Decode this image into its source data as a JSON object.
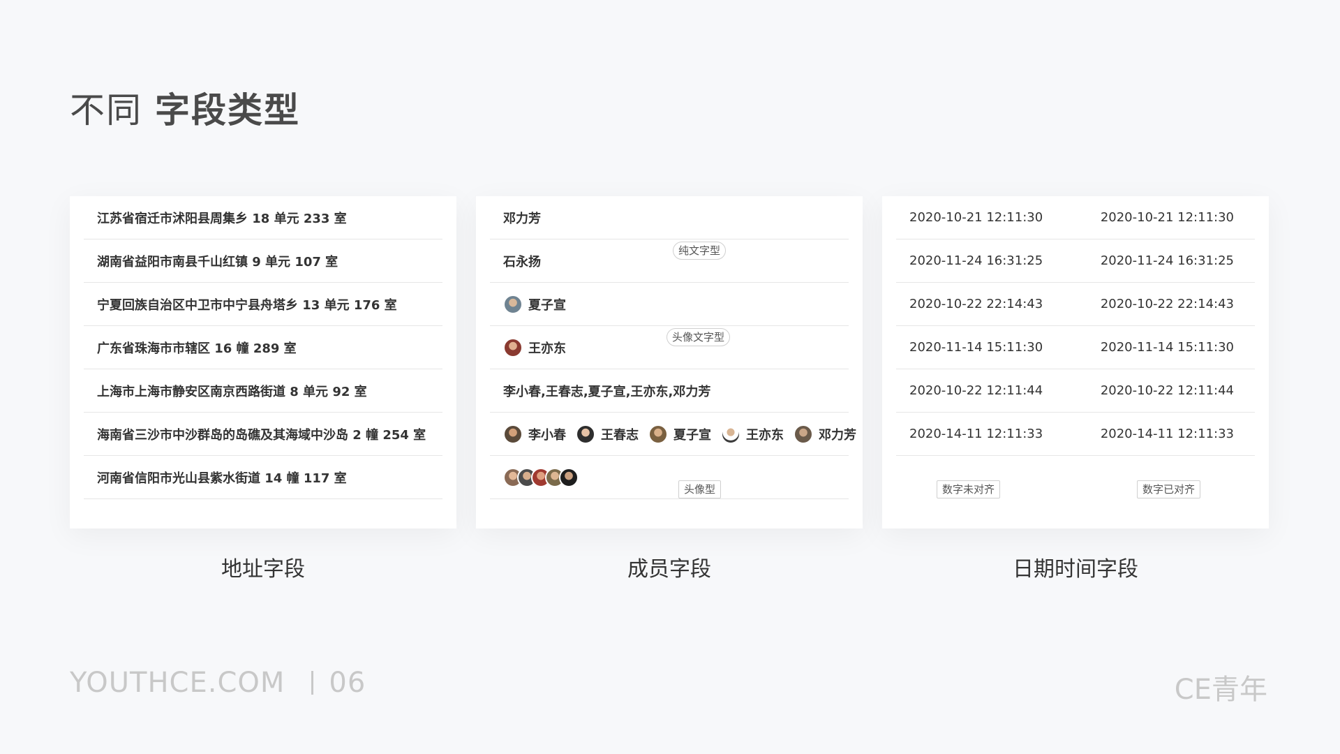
{
  "title": {
    "light": "不同",
    "bold": "字段类型"
  },
  "address_card": {
    "rows": [
      "江苏省宿迁市沭阳县周集乡 18 单元 233 室",
      "湖南省益阳市南县千山红镇 9 单元 107 室",
      "宁夏回族自治区中卫市中宁县舟塔乡 13 单元 176 室",
      "广东省珠海市市辖区 16 幢 289 室",
      "上海市上海市静安区南京西路街道 8 单元 92 室",
      "海南省三沙市中沙群岛的岛礁及其海域中沙岛 2 幢 254 室",
      "河南省信阳市光山县紫水街道 14 幢 117 室"
    ],
    "caption": "地址字段"
  },
  "member_card": {
    "text_rows": [
      "邓力芳",
      "石永扬"
    ],
    "avatar_rows": [
      "夏子宣",
      "王亦东"
    ],
    "multi_text": "李小春,王春志,夏子宣,王亦东,邓力芳",
    "multi_members": [
      "李小春",
      "王春志",
      "夏子宣",
      "王亦东",
      "邓力芳"
    ],
    "tag_text": "纯文字型",
    "tag_avatar_text": "头像文字型",
    "tag_avatar": "头像型",
    "caption": "成员字段"
  },
  "datetime_card": {
    "rows": [
      [
        "2020-10-21 12:11:30",
        "2020-10-21 12:11:30"
      ],
      [
        "2020-11-24 16:31:25",
        "2020-11-24 16:31:25"
      ],
      [
        "2020-10-22 22:14:43",
        "2020-10-22 22:14:43"
      ],
      [
        "2020-11-14 15:11:30",
        "2020-11-14 15:11:30"
      ],
      [
        "2020-10-22 12:11:44",
        "2020-10-22 12:11:44"
      ],
      [
        "2020-14-11 12:11:33",
        "2020-14-11 12:11:33"
      ]
    ],
    "tag_unaligned": "数字未对齐",
    "tag_aligned": "数字已对齐",
    "caption": "日期时间字段"
  },
  "footer": {
    "site": "YOUTHCE.COM",
    "page": "06",
    "brand": "CE青年"
  },
  "avatar_colors": [
    "#8a6a55",
    "#4b4b4b",
    "#a07a5a",
    "#5d6d7a",
    "#7a5a45"
  ]
}
